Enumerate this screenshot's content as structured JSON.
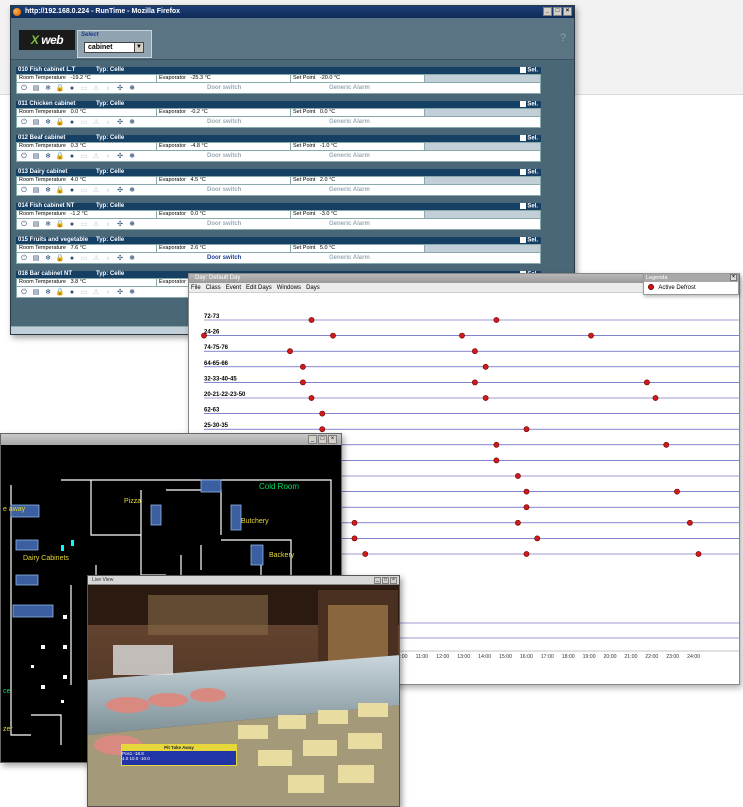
{
  "browser": {
    "title": "http://192.168.0.224 - RunTime - Mozilla Firefox",
    "logo_text": "web",
    "select_label": "Select",
    "select_value": "cabinet",
    "help": "?",
    "cabinets": [
      {
        "name": "010 Fish cabinet L.T",
        "type": "Typ: Celle",
        "sel": "Sel.",
        "room_label": "Room Temperature",
        "room": "-19.2 °C",
        "evap_label": "Evaporator",
        "evap": "-25.3 °C",
        "sp_label": "Set Point",
        "sp": "-20.0 °C",
        "door": "Door switch",
        "door_active": false,
        "alarm": "Generic Alarm"
      },
      {
        "name": "011 Chicken cabinet",
        "type": "Typ: Celle",
        "sel": "Sel.",
        "room_label": "Room Temperature",
        "room": "0.0 °C",
        "evap_label": "Evaporator",
        "evap": "-0.2 °C",
        "sp_label": "Set Point",
        "sp": "0.0 °C",
        "door": "Door switch",
        "door_active": false,
        "alarm": "Generic Alarm"
      },
      {
        "name": "012 Beaf cabinet",
        "type": "Typ: Celle",
        "sel": "Sel.",
        "room_label": "Room Temperature",
        "room": "0.3 °C",
        "evap_label": "Evaporator",
        "evap": "-4.8 °C",
        "sp_label": "Set Point",
        "sp": "-1.0 °C",
        "door": "Door switch",
        "door_active": false,
        "alarm": "Generic Alarm"
      },
      {
        "name": "013 Dairy cabinet",
        "type": "Typ: Celle",
        "sel": "Sel.",
        "room_label": "Room Temperature",
        "room": "4.0 °C",
        "evap_label": "Evaporator",
        "evap": "4.5 °C",
        "sp_label": "Set Point",
        "sp": "2.0 °C",
        "door": "Door switch",
        "door_active": false,
        "alarm": "Generic Alarm"
      },
      {
        "name": "014 Fish cabinet NT",
        "type": "Typ: Celle",
        "sel": "Sel.",
        "room_label": "Room Temperature",
        "room": "-1.2 °C",
        "evap_label": "Evaporator",
        "evap": "0.0 °C",
        "sp_label": "Set Point",
        "sp": "-3.0 °C",
        "door": "Door switch",
        "door_active": false,
        "alarm": "Generic Alarm"
      },
      {
        "name": "015 Fruits and vegetable",
        "type": "Typ: Celle",
        "sel": "Sel.",
        "room_label": "Room Temperature",
        "room": "7.6 °C",
        "evap_label": "Evaporator",
        "evap": "2.6 °C",
        "sp_label": "Set Point",
        "sp": "5.0 °C",
        "door": "Door switch",
        "door_active": true,
        "alarm": "Generic Alarm"
      },
      {
        "name": "016 Bar cabinet NT",
        "type": "Typ: Celle",
        "sel": "Sel.",
        "room_label": "Room Temperature",
        "room": "3.8 °C",
        "evap_label": "Evaporator",
        "evap": "",
        "sp_label": "",
        "sp": "",
        "door": "",
        "door_active": false,
        "alarm": ""
      }
    ],
    "icons": [
      "power-icon",
      "display-icon",
      "defrost-icon",
      "lock-icon",
      "light-icon",
      "door-icon",
      "alarm-icon",
      "bulb-icon",
      "fan-icon",
      "snowflake-icon"
    ]
  },
  "defrost_window": {
    "title": "Day: Default Day",
    "menu": [
      "File",
      "Class",
      "Event",
      "Edit Days",
      "Windows",
      "Days"
    ],
    "legend_title": "Legenda",
    "legend_item": "Active Defrost",
    "colors": {
      "point": "#d11a1a",
      "line": "#3b3bb0"
    }
  },
  "chart_data": {
    "type": "scatter",
    "title": "Day: Default Day",
    "xlabel": "",
    "ylabel": "",
    "x_ticks": [
      "10:00",
      "11:00",
      "12:00",
      "13:00",
      "14:00",
      "15:00",
      "16:00",
      "17:00",
      "18:00",
      "19:00",
      "20:00",
      "21:00",
      "22:00",
      "23:00",
      "24:00"
    ],
    "xlim": [
      0,
      24
    ],
    "rows": [
      {
        "label": "72-73",
        "points": [
          5.0,
          13.6
        ]
      },
      {
        "label": "24-26",
        "points": [
          0.0,
          6.0,
          12.0,
          18.0
        ]
      },
      {
        "label": "74-75-76",
        "points": [
          4.0,
          12.6
        ]
      },
      {
        "label": "64-65-66",
        "points": [
          4.6,
          13.1
        ]
      },
      {
        "label": "32-33-40-45",
        "points": [
          4.6,
          12.6,
          20.6
        ]
      },
      {
        "label": "20-21-22-23-50",
        "points": [
          5.0,
          13.1,
          21.0
        ]
      },
      {
        "label": "62-63",
        "points": [
          5.5
        ]
      },
      {
        "label": "25-30-35",
        "points": [
          5.5,
          15.0
        ]
      },
      {
        "label": "",
        "points": [
          6.0,
          13.6,
          21.5
        ]
      },
      {
        "label": "",
        "points": [
          13.6
        ]
      },
      {
        "label": "",
        "points": [
          14.6
        ]
      },
      {
        "label": "",
        "points": [
          15.0,
          22.0
        ]
      },
      {
        "label": "",
        "points": [
          15.0
        ]
      },
      {
        "label": "",
        "points": [
          7.0,
          14.6,
          22.6
        ]
      },
      {
        "label": "",
        "points": [
          7.0,
          15.5
        ]
      },
      {
        "label": "",
        "points": [
          7.5,
          15.0,
          23.0
        ]
      }
    ]
  },
  "plan": {
    "labels": {
      "cold_room": "Cold Room",
      "pizza": "Pizza",
      "butchery": "Butchery",
      "backery": "Backery",
      "dairy": "Dairy Cabinets",
      "take_away": "e away",
      "ce": "ce",
      "zer": "zer"
    }
  },
  "camera": {
    "menu": "Live View",
    "overlay_title": "Pit Take Away",
    "overlay_lines": [
      "Pos1  -18.8",
      "4.0  10.0  -10.0"
    ]
  }
}
